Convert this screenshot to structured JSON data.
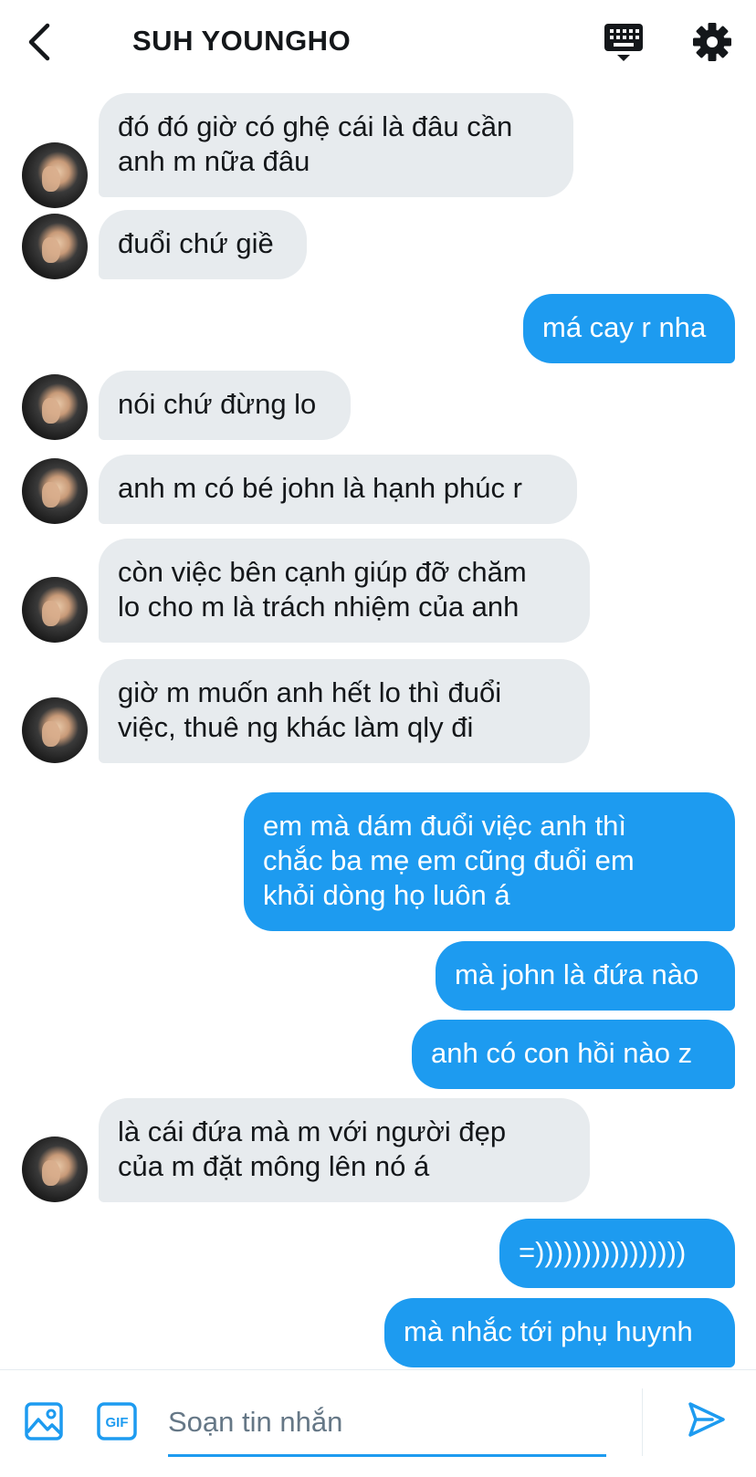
{
  "header": {
    "back_icon": "chevron-left-icon",
    "title": "SUH YOUNGHO",
    "keyboard_icon": "keyboard-icon",
    "settings_icon": "gear-icon"
  },
  "messages": [
    {
      "side": "in",
      "text": "đó đó giờ có ghệ cái là đâu cần\nanh m nữa đâu"
    },
    {
      "side": "in",
      "text": "đuổi chứ giề"
    },
    {
      "side": "out",
      "text": "má cay r nha"
    },
    {
      "side": "in",
      "text": "nói chứ đừng lo"
    },
    {
      "side": "in",
      "text": "anh m có bé john là hạnh phúc r"
    },
    {
      "side": "in",
      "text": "còn việc bên cạnh giúp đỡ chăm\nlo cho m là trách nhiệm của anh"
    },
    {
      "side": "in",
      "text": "giờ m muốn anh hết lo thì đuổi\nviệc, thuê ng khác làm qly đi"
    },
    {
      "side": "out",
      "text": "em mà dám đuổi việc anh thì\nchắc ba mẹ em cũng đuổi em\nkhỏi dòng họ luôn á"
    },
    {
      "side": "out",
      "text": "mà john là đứa nào"
    },
    {
      "side": "out",
      "text": "anh có con hồi nào z"
    },
    {
      "side": "in",
      "text": "là cái đứa mà m với người đẹp\ncủa m đặt mông lên nó á"
    },
    {
      "side": "out",
      "text": "=))))))))))))))))"
    },
    {
      "side": "out",
      "text": "mà nhắc tới phụ huynh"
    }
  ],
  "composer": {
    "image_icon": "image-icon",
    "gif_icon": "gif-icon",
    "gif_label": "GIF",
    "placeholder": "Soạn tin nhắn",
    "value": "",
    "send_icon": "send-icon"
  },
  "colors": {
    "accent": "#1d9bf0",
    "incoming_bubble": "#e7ebee",
    "text": "#14171a",
    "placeholder": "#657786"
  }
}
